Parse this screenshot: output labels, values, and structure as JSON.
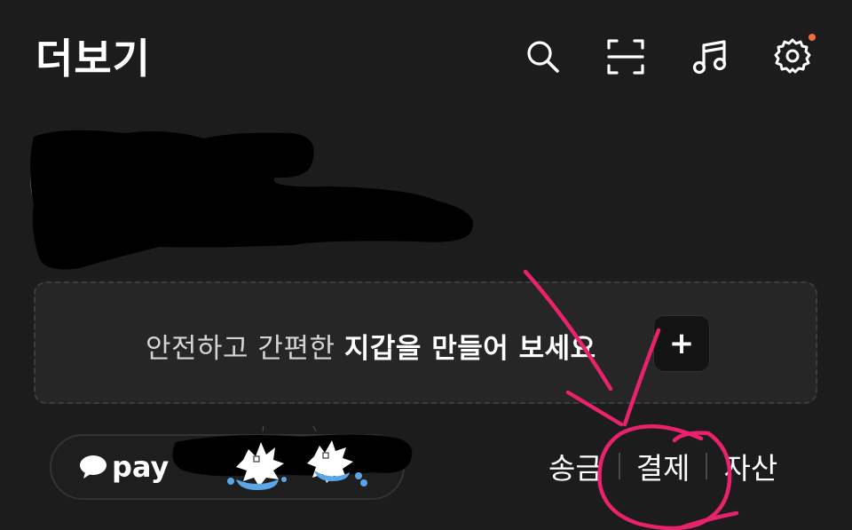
{
  "header": {
    "title": "더보기",
    "icons": [
      "search-icon",
      "scan-icon",
      "music-icon",
      "settings-icon"
    ],
    "notification_color": "#f2703a"
  },
  "wallet": {
    "text_plain": "안전하고 간편한 ",
    "text_bold": "지갑을 만들어 보세요",
    "add_label": "+"
  },
  "pay": {
    "logo_text": "pay",
    "menu": [
      {
        "label": "송금"
      },
      {
        "label": "결제"
      },
      {
        "label": "자산"
      }
    ]
  },
  "colors": {
    "background": "#1c1c1c",
    "banner": "#262626",
    "annotation": "#e8226b"
  }
}
